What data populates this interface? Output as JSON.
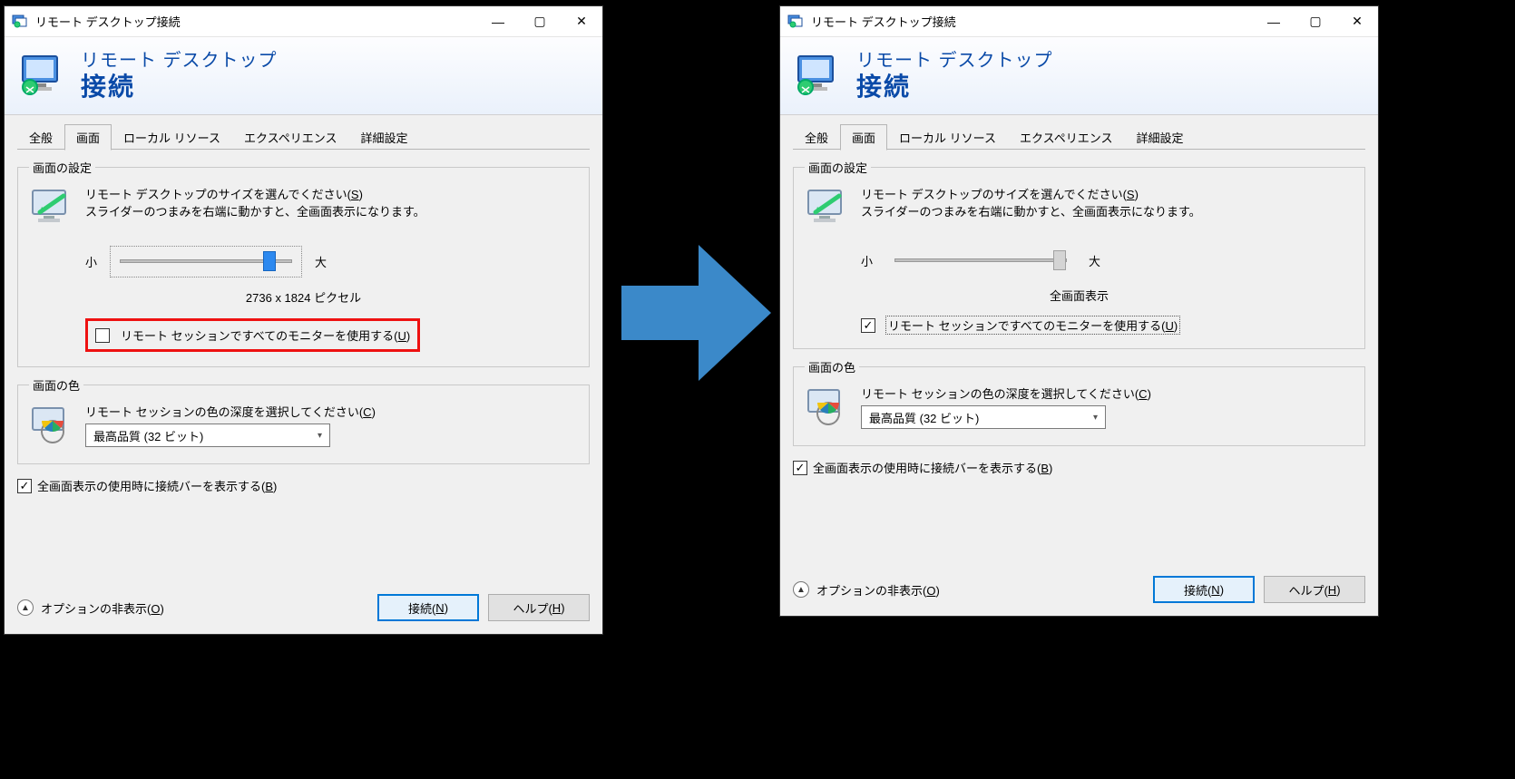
{
  "accent": "#0a4aa8",
  "window_title": "リモート デスクトップ接続",
  "banner": {
    "line1": "リモート デスクトップ",
    "line2": "接続"
  },
  "tabs": [
    "全般",
    "画面",
    "ローカル リソース",
    "エクスペリエンス",
    "詳細設定"
  ],
  "active_tab_index": 1,
  "group_display": {
    "title": "画面の設定",
    "desc_line1_prefix": "リモート デスクトップのサイズを選んでください(",
    "desc_line1_hotkey": "S",
    "desc_line1_suffix": ")",
    "desc_line2": "スライダーのつまみを右端に動かすと、全画面表示になります。",
    "min_label": "小",
    "max_label": "大",
    "use_all_monitors_prefix": "リモート セッションですべてのモニターを使用する(",
    "use_all_monitors_hotkey": "U",
    "use_all_monitors_suffix": ")"
  },
  "group_color": {
    "title": "画面の色",
    "desc_prefix": "リモート セッションの色の深度を選択してください(",
    "desc_hotkey": "C",
    "desc_suffix": ")",
    "selected": "最高品質 (32 ビット)"
  },
  "connbar": {
    "prefix": "全画面表示の使用時に接続バーを表示する(",
    "hotkey": "B",
    "suffix": ")"
  },
  "footer": {
    "collapse_prefix": "オプションの非表示(",
    "collapse_hotkey": "O",
    "collapse_suffix": ")",
    "connect_prefix": "接続(",
    "connect_hotkey": "N",
    "connect_suffix": ")",
    "help_prefix": "ヘルプ(",
    "help_hotkey": "H",
    "help_suffix": ")"
  },
  "left": {
    "resolution_text": "2736 x 1824 ピクセル",
    "slider_value": 90,
    "use_all_monitors_checked": false,
    "highlight": true
  },
  "right": {
    "resolution_text": "全画面表示",
    "slider_value": 100,
    "use_all_monitors_checked": true,
    "highlight": false
  }
}
